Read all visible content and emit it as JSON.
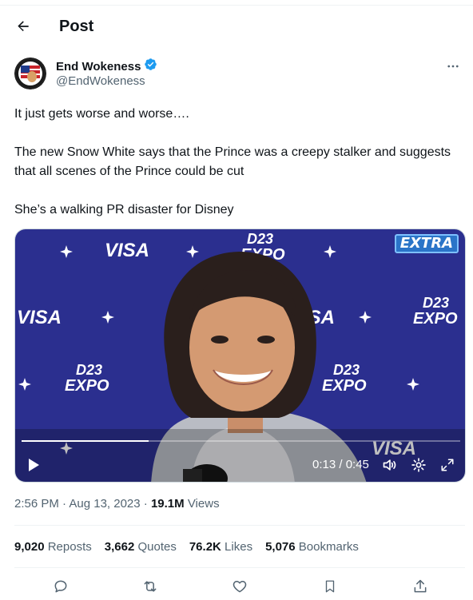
{
  "header": {
    "title": "Post",
    "back_icon": "arrow-left-icon"
  },
  "author": {
    "name": "End Wokeness",
    "handle": "@EndWokeness",
    "verified_color": "#1d9bf0",
    "more_icon": "ellipsis-icon"
  },
  "tweet": {
    "lines": [
      "It just gets worse and worse….",
      "The new Snow White says that the Prince was a creepy stalker and suggests that all scenes of the Prince could be cut",
      "She’s a walking PR disaster for Disney"
    ]
  },
  "video": {
    "logo": "EXTRA",
    "backdrop_words": [
      "VISA",
      "D23",
      "EXPO"
    ],
    "time": "0:13 / 0:45",
    "progress": 0.29,
    "play_icon": "play-icon",
    "volume_icon": "volume-icon",
    "settings_icon": "gear-icon",
    "fullscreen_icon": "expand-icon"
  },
  "meta": {
    "timestamp": "2:56 PM · Aug 13, 2023 · ",
    "views_count": "19.1M",
    "views_label": " Views"
  },
  "stats": [
    {
      "count": "9,020",
      "label": "Reposts"
    },
    {
      "count": "3,662",
      "label": "Quotes"
    },
    {
      "count": "76.2K",
      "label": "Likes"
    },
    {
      "count": "5,076",
      "label": "Bookmarks"
    }
  ],
  "actions": [
    "reply-icon",
    "repost-icon",
    "like-icon",
    "bookmark-icon",
    "share-icon"
  ],
  "colors": {
    "text": "#0f1419",
    "secondary": "#536471",
    "backdrop": "#2b2f8f"
  }
}
